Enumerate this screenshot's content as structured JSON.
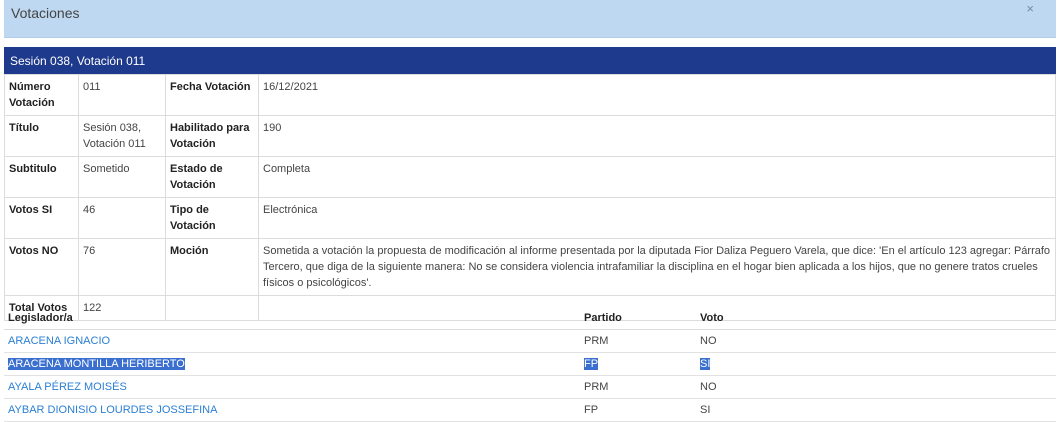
{
  "dialog": {
    "title": "Votaciones",
    "close": "×"
  },
  "session_header": "Sesión 038, Votación 011",
  "details": {
    "numero_label": "Número Votación",
    "numero_value": "011",
    "fecha_label": "Fecha Votación",
    "fecha_value": "16/12/2021",
    "titulo_label": "Título",
    "titulo_value": "Sesión 038, Votación 011",
    "habilitado_label": "Habilitado para Votación",
    "habilitado_value": "190",
    "subtitulo_label": "Subtitulo",
    "subtitulo_value": "Sometido",
    "estado_label": "Estado de Votación",
    "estado_value": "Completa",
    "votos_si_label": "Votos SI",
    "votos_si_value": "46",
    "tipo_label": "Tipo de Votación",
    "tipo_value": "Electrónica",
    "votos_no_label": "Votos NO",
    "votos_no_value": "76",
    "mocion_label": "Moción",
    "mocion_value": "Sometida a votación la propuesta de modificación al informe presentada por la diputada Fior Daliza Peguero Varela, que dice: 'En el artículo 123 agregar: Párrafo Tercero, que diga de la siguiente manera: No se considera violencia intrafamiliar la disciplina en el hogar bien aplicada a los hijos, que no genere tratos crueles físicos o psicológicos'.",
    "total_label": "Total Votos",
    "total_value": "122"
  },
  "legisladores": {
    "headers": {
      "name": "Legislador/a",
      "party": "Partido",
      "vote": "Voto"
    },
    "rows": [
      {
        "name": "ARACENA IGNACIO",
        "party": "PRM",
        "vote": "NO"
      },
      {
        "name": "ARACENA MONTILLA HERIBERTO",
        "party": "FP",
        "vote": "SI"
      },
      {
        "name": "AYALA PÉREZ MOISÉS",
        "party": "PRM",
        "vote": "NO"
      },
      {
        "name": "AYBAR DIONISIO LOURDES JOSSEFINA",
        "party": "FP",
        "vote": "SI"
      }
    ]
  }
}
